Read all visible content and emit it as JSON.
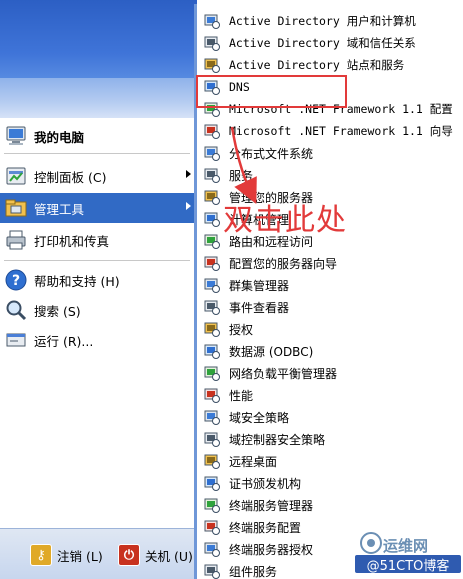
{
  "left_menu": {
    "items": [
      {
        "label": "我的电脑",
        "icon": "my-computer-icon"
      },
      {
        "label": "控制面板 (C)",
        "icon": "control-panel-icon",
        "has_submenu": true
      },
      {
        "label": "管理工具",
        "icon": "admin-tools-icon",
        "has_submenu": true,
        "selected": true
      },
      {
        "label": "打印机和传真",
        "icon": "printer-fax-icon"
      },
      {
        "label": "帮助和支持 (H)",
        "icon": "help-icon"
      },
      {
        "label": "搜索 (S)",
        "icon": "search-icon"
      },
      {
        "label": "运行 (R)...",
        "icon": "run-icon"
      }
    ],
    "footer": {
      "logoff_label": "注销 (L)",
      "shutdown_label": "关机 (U)"
    }
  },
  "submenu": {
    "items": [
      {
        "label": "Active Directory 用户和计算机",
        "icon": "ad-users-computers-icon"
      },
      {
        "label": "Active Directory 域和信任关系",
        "icon": "ad-domains-trusts-icon"
      },
      {
        "label": "Active Directory 站点和服务",
        "icon": "ad-sites-services-icon"
      },
      {
        "label": "DNS",
        "icon": "dns-icon"
      },
      {
        "label": "Microsoft .NET Framework 1.1 配置",
        "icon": "dotnet-config-icon"
      },
      {
        "label": "Microsoft .NET Framework 1.1 向导",
        "icon": "dotnet-wizard-icon"
      },
      {
        "label": "分布式文件系统",
        "icon": "dfs-icon"
      },
      {
        "label": "服务",
        "icon": "services-icon"
      },
      {
        "label": "管理您的服务器",
        "icon": "manage-server-icon"
      },
      {
        "label": "计算机管理",
        "icon": "computer-management-icon"
      },
      {
        "label": "路由和远程访问",
        "icon": "routing-remote-access-icon"
      },
      {
        "label": "配置您的服务器向导",
        "icon": "configure-server-wizard-icon"
      },
      {
        "label": "群集管理器",
        "icon": "cluster-manager-icon"
      },
      {
        "label": "事件查看器",
        "icon": "event-viewer-icon"
      },
      {
        "label": "授权",
        "icon": "licensing-icon"
      },
      {
        "label": "数据源 (ODBC)",
        "icon": "odbc-icon"
      },
      {
        "label": "网络负载平衡管理器",
        "icon": "nlb-manager-icon"
      },
      {
        "label": "性能",
        "icon": "performance-icon"
      },
      {
        "label": "域安全策略",
        "icon": "domain-security-policy-icon"
      },
      {
        "label": "域控制器安全策略",
        "icon": "dc-security-policy-icon"
      },
      {
        "label": "远程桌面",
        "icon": "remote-desktop-icon"
      },
      {
        "label": "证书颁发机构",
        "icon": "certificate-authority-icon"
      },
      {
        "label": "终端服务管理器",
        "icon": "terminal-services-manager-icon"
      },
      {
        "label": "终端服务配置",
        "icon": "terminal-services-config-icon"
      },
      {
        "label": "终端服务器授权",
        "icon": "terminal-server-licensing-icon"
      },
      {
        "label": "组件服务",
        "icon": "component-services-icon"
      }
    ]
  },
  "annotation": {
    "text": "双击此处",
    "color": "#e23a3a"
  },
  "watermark": {
    "top_text": "运维网",
    "bottom_text": "@51CTO博客"
  },
  "colors": {
    "selection": "#316ac5",
    "header_blue": "#2c5fc4",
    "highlight_red": "#e23a3a"
  }
}
